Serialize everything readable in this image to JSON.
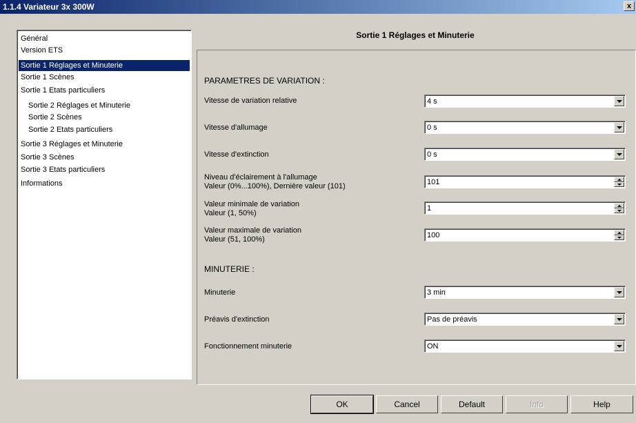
{
  "window": {
    "title": "1.1.4 Variateur 3x 300W",
    "close_label": "x"
  },
  "nav": {
    "items": [
      {
        "label": "Général"
      },
      {
        "label": "Version ETS"
      },
      {
        "label": "Sortie 1 Réglages et Minuterie",
        "selected": true
      },
      {
        "label": "Sortie 1 Scènes"
      },
      {
        "label": "Sortie 1 Etats particuliers"
      },
      {
        "label": "Sortie 2 Réglages et Minuterie"
      },
      {
        "label": "Sortie 2 Scènes"
      },
      {
        "label": "Sortie 2 Etats particuliers"
      },
      {
        "label": "Sortie 3 Réglages et Minuterie"
      },
      {
        "label": "Sortie 3 Scènes"
      },
      {
        "label": "Sortie 3 Etats particuliers"
      },
      {
        "label": "Informations"
      }
    ]
  },
  "panel": {
    "title": "Sortie 1 Réglages et Minuterie",
    "section_variation": "PARAMETRES DE VARIATION :",
    "section_minuterie": "MINUTERIE :",
    "params": [
      {
        "label": "Vitesse de variation relative",
        "value": "4 s",
        "control": "dropdown"
      },
      {
        "label": "Vitesse d'allumage",
        "value": "0 s",
        "control": "dropdown"
      },
      {
        "label": "Vitesse d'extinction",
        "value": "0 s",
        "control": "dropdown"
      },
      {
        "label": "Niveau d'éclairement à l'allumage",
        "sublabel": "Valeur (0%...100%), Dernière valeur (101)",
        "value": "101",
        "control": "spinner"
      },
      {
        "label": "Valeur minimale de variation",
        "sublabel": "Valeur (1, 50%)",
        "value": "1",
        "control": "spinner"
      },
      {
        "label": "Valeur maximale de variation",
        "sublabel": "Valeur (51, 100%)",
        "value": "100",
        "control": "spinner"
      },
      {
        "label": "Minuterie",
        "value": "3 min",
        "control": "dropdown"
      },
      {
        "label": "Préavis d'extinction",
        "value": "Pas de préavis",
        "control": "dropdown"
      },
      {
        "label": "Fonctionnement minuterie",
        "value": "ON",
        "control": "dropdown"
      }
    ]
  },
  "buttons": {
    "ok": "OK",
    "cancel": "Cancel",
    "default": "Default",
    "info": "Info",
    "help": "Help"
  },
  "colors": {
    "selection": "#0a246a",
    "title_gradient_start": "#0a246a",
    "title_gradient_end": "#a6caf0",
    "face": "#d4d0c8"
  }
}
